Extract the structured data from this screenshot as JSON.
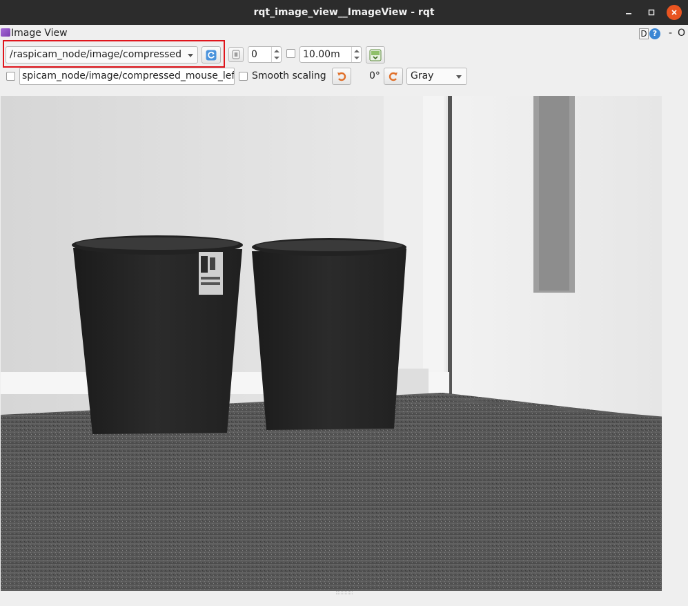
{
  "window": {
    "title": "rqt_image_view__ImageView - rqt"
  },
  "plugin": {
    "title": "Image View",
    "d_label": "D",
    "help_label": "?",
    "dash_label": "-",
    "o_label": "O"
  },
  "toolbar": {
    "topic_value": "/raspicam_node/image/compressed",
    "number_value": "0",
    "duration_value": "10.00m",
    "mouse_topic_value": "spicam_node/image/compressed_mouse_left",
    "smooth_scaling_label": "Smooth scaling",
    "rotation_label": "0°",
    "color_scheme_value": "Gray"
  },
  "icons": [
    "refresh-icon",
    "pause-icon",
    "save-icon",
    "rotate-left-icon",
    "rotate-right-icon",
    "help-icon",
    "minimize-icon",
    "maximize-icon",
    "close-icon"
  ],
  "colors": {
    "titlebar": "#2c2c2c",
    "close_button": "#e95420",
    "highlight_border": "#e0141b",
    "help_icon": "#3a86d4"
  }
}
